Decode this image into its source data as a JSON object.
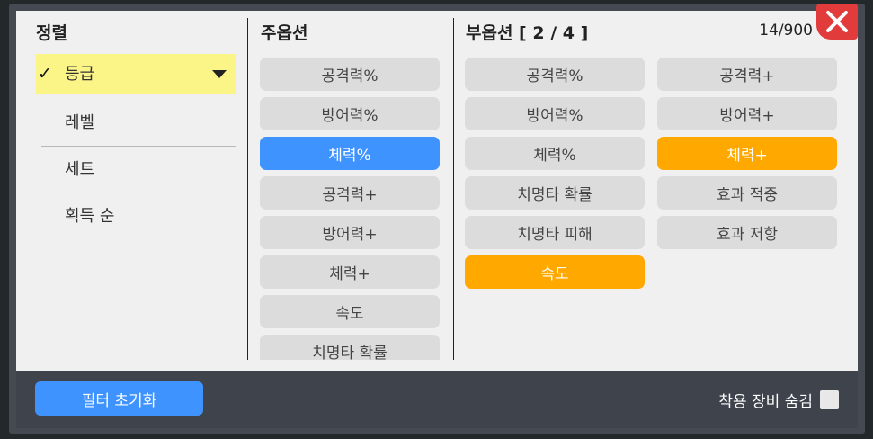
{
  "sort": {
    "title": "정렬",
    "items": [
      {
        "label": "등급",
        "selected": true
      },
      {
        "label": "레벨"
      },
      {
        "label": "세트"
      },
      {
        "label": "획득 순"
      }
    ]
  },
  "main_option": {
    "title": "주옵션",
    "items": [
      {
        "label": "공격력%",
        "state": "off"
      },
      {
        "label": "방어력%",
        "state": "off"
      },
      {
        "label": "체력%",
        "state": "selected"
      },
      {
        "label": "공격력+",
        "state": "off"
      },
      {
        "label": "방어력+",
        "state": "off"
      },
      {
        "label": "체력+",
        "state": "off"
      },
      {
        "label": "속도",
        "state": "off"
      },
      {
        "label": "치명타 확률",
        "state": "off"
      }
    ]
  },
  "sub_option": {
    "title": "부옵션 [ 2 / 4 ]",
    "count": "14/900",
    "left": [
      {
        "label": "공격력%",
        "state": "off"
      },
      {
        "label": "방어력%",
        "state": "off"
      },
      {
        "label": "체력%",
        "state": "off"
      },
      {
        "label": "치명타 확률",
        "state": "off"
      },
      {
        "label": "치명타 피해",
        "state": "off"
      },
      {
        "label": "속도",
        "state": "selected"
      }
    ],
    "right": [
      {
        "label": "공격력+",
        "state": "off"
      },
      {
        "label": "방어력+",
        "state": "off"
      },
      {
        "label": "체력+",
        "state": "selected"
      },
      {
        "label": "효과 적중",
        "state": "off"
      },
      {
        "label": "효과 저항",
        "state": "off"
      }
    ]
  },
  "footer": {
    "reset_label": "필터 초기화",
    "hide_equipped_label": "착용 장비 숨김",
    "hide_equipped_checked": false
  },
  "colors": {
    "main_selected": "#3e93ff",
    "sub_selected": "#ffa800",
    "sort_highlight": "#fbf487",
    "close": "#e23b3b"
  },
  "icons": {
    "close": "close-x-icon",
    "check": "checkmark-icon",
    "caret": "caret-down-icon"
  }
}
